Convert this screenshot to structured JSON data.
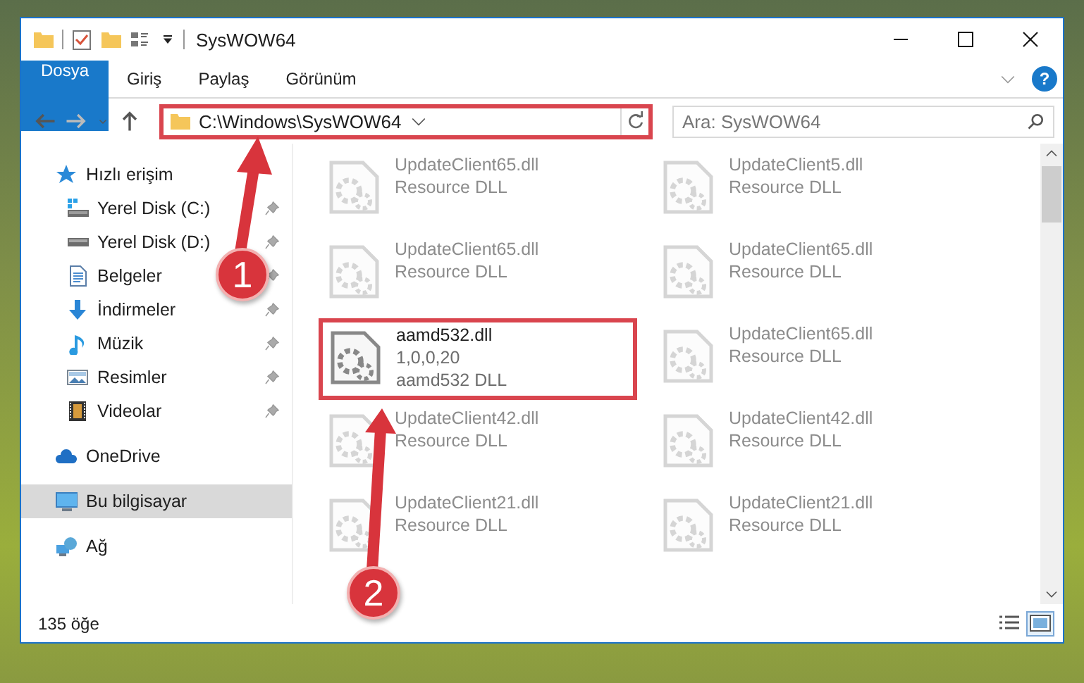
{
  "window": {
    "title": "SysWOW64"
  },
  "ribbon_tabs": [
    {
      "label": "Dosya",
      "kind": "file"
    },
    {
      "label": "Giriş",
      "kind": "tab"
    },
    {
      "label": "Paylaş",
      "kind": "tab"
    },
    {
      "label": "Görünüm",
      "kind": "tab"
    }
  ],
  "help": {
    "label": "?"
  },
  "address": {
    "path": "C:\\Windows\\SysWOW64",
    "annotated": true
  },
  "search": {
    "placeholder": "Ara: SysWOW64"
  },
  "sidebar": {
    "items": [
      {
        "label": "Hızlı erişim",
        "kind": "star",
        "selected": false,
        "children": [
          {
            "label": "Yerel Disk (C:)",
            "kind": "sysdrive",
            "pinned": true,
            "selected": false
          },
          {
            "label": "Yerel Disk (D:)",
            "kind": "drive",
            "pinned": true,
            "selected": false
          },
          {
            "label": "Belgeler",
            "kind": "documents",
            "pinned": true,
            "selected": false
          },
          {
            "label": "İndirmeler",
            "kind": "download",
            "pinned": true,
            "selected": false
          },
          {
            "label": "Müzik",
            "kind": "music",
            "pinned": true,
            "selected": false
          },
          {
            "label": "Resimler",
            "kind": "pictures",
            "pinned": true,
            "selected": false
          },
          {
            "label": "Videolar",
            "kind": "videos",
            "pinned": true,
            "selected": false
          }
        ]
      },
      {
        "label": "OneDrive",
        "kind": "cloud",
        "selected": false
      },
      {
        "label": "Bu bilgisayar",
        "kind": "computer",
        "selected": true
      },
      {
        "label": "Ağ",
        "kind": "network",
        "selected": false
      }
    ]
  },
  "files": [
    {
      "name": "UpdateClient65.dll",
      "lines": [
        "Resource DLL"
      ],
      "dimmed": true,
      "annotated": false
    },
    {
      "name": "UpdateClient5.dll",
      "lines": [
        "Resource DLL"
      ],
      "dimmed": true,
      "annotated": false
    },
    {
      "name": "UpdateClient65.dll",
      "lines": [
        "Resource DLL"
      ],
      "dimmed": true,
      "annotated": false
    },
    {
      "name": "UpdateClient65.dll",
      "lines": [
        "Resource DLL"
      ],
      "dimmed": true,
      "annotated": false
    },
    {
      "name": "aamd532.dll",
      "lines": [
        "1,0,0,20",
        "aamd532 DLL"
      ],
      "dimmed": false,
      "annotated": true
    },
    {
      "name": "UpdateClient65.dll",
      "lines": [
        "Resource DLL"
      ],
      "dimmed": true,
      "annotated": false
    },
    {
      "name": "UpdateClient42.dll",
      "lines": [
        "Resource DLL"
      ],
      "dimmed": true,
      "annotated": false
    },
    {
      "name": "UpdateClient42.dll",
      "lines": [
        "Resource DLL"
      ],
      "dimmed": true,
      "annotated": false
    },
    {
      "name": "UpdateClient21.dll",
      "lines": [
        "Resource DLL"
      ],
      "dimmed": true,
      "annotated": false
    },
    {
      "name": "UpdateClient21.dll",
      "lines": [
        "Resource DLL"
      ],
      "dimmed": true,
      "annotated": false
    }
  ],
  "status_bar": {
    "count": "135 öğe",
    "views": [
      {
        "kind": "details",
        "selected": false
      },
      {
        "kind": "large",
        "selected": true
      }
    ]
  },
  "callouts": [
    {
      "number": "1"
    },
    {
      "number": "2"
    }
  ]
}
